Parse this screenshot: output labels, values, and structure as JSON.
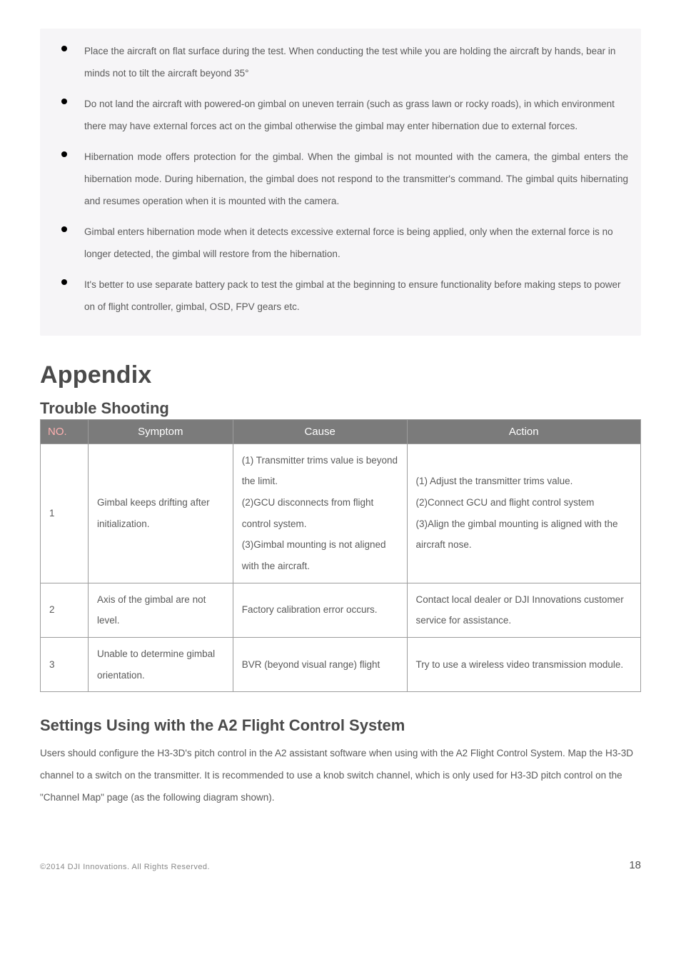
{
  "notice": {
    "items": [
      "Place the aircraft on flat surface during the test. When conducting the test while you are holding the aircraft by hands, bear in minds not to tilt the aircraft beyond 35°",
      "Do not land the aircraft with powered-on gimbal on uneven terrain (such as grass lawn or rocky roads), in which environment there may have external forces act on the gimbal otherwise the gimbal may enter hibernation due to external forces.",
      "Hibernation mode offers protection for the gimbal. When the gimbal is not mounted with the camera, the gimbal enters the hibernation mode. During hibernation, the gimbal does not respond to the transmitter's command. The gimbal quits hibernating and resumes operation when it is mounted with the camera.",
      "Gimbal enters hibernation mode when it detects excessive external force is being applied, only when the external force is no longer detected, the gimbal will restore from the hibernation.",
      "It's better to use separate battery pack to test the gimbal at the beginning to ensure functionality before making steps to power on of flight controller, gimbal, OSD, FPV gears etc."
    ]
  },
  "appendix": {
    "title": "Appendix",
    "trouble": {
      "title": "Trouble Shooting",
      "headers": {
        "no": "NO.",
        "symptom": "Symptom",
        "cause": "Cause",
        "action": "Action"
      },
      "rows": [
        {
          "no": "1",
          "symptom": "Gimbal keeps drifting after initialization.",
          "cause": "(1) Transmitter trims value is beyond the limit.\n(2)GCU disconnects from flight control system.\n(3)Gimbal mounting is not aligned with the aircraft.",
          "action": "(1) Adjust the transmitter trims value.\n(2)Connect GCU and flight control system\n(3)Align the gimbal mounting is aligned with the aircraft nose."
        },
        {
          "no": "2",
          "symptom": "Axis of the gimbal are not level.",
          "cause": "Factory calibration error occurs.",
          "action": "Contact local dealer or DJI Innovations customer service for assistance."
        },
        {
          "no": "3",
          "symptom": "Unable to determine gimbal orientation.",
          "cause": "BVR (beyond visual range) flight",
          "action": "Try to use a wireless video transmission module."
        }
      ]
    },
    "settings": {
      "title": "Settings Using with the A2 Flight Control System",
      "body": "Users should configure the H3-3D's pitch control in the A2 assistant software when using with the A2 Flight Control System. Map the H3-3D channel to a switch on the transmitter. It is recommended to use a knob switch channel, which is only used for H3-3D pitch control on the \"Channel Map\" page (as the following diagram shown)."
    }
  },
  "footer": {
    "copyright": "©2014 DJI Innovations. All Rights Reserved.",
    "page": "18"
  }
}
